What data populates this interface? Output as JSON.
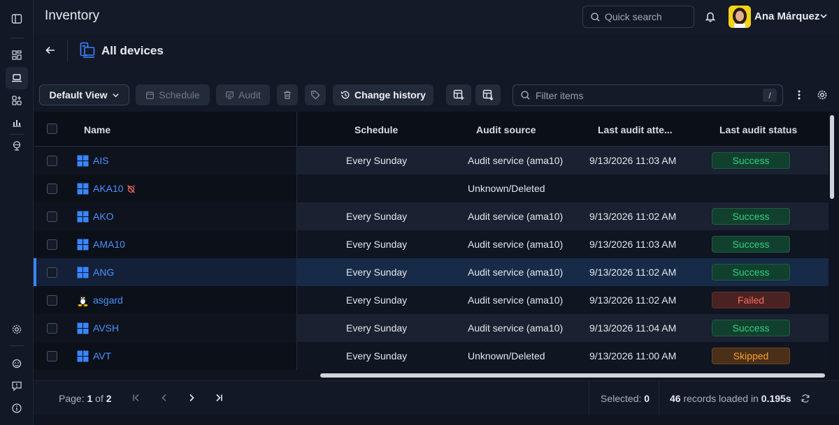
{
  "header": {
    "app_title": "Inventory",
    "search_placeholder": "Quick search",
    "user_name": "Ana Márquez"
  },
  "subheader": {
    "title": "All devices"
  },
  "toolbar": {
    "view_label": "Default View",
    "schedule_label": "Schedule",
    "audit_label": "Audit",
    "change_history_label": "Change history",
    "filter_placeholder": "Filter items",
    "filter_shortcut": "/"
  },
  "table": {
    "columns": [
      "Name",
      "Schedule",
      "Audit source",
      "Last audit atte...",
      "Last audit status"
    ],
    "rows": [
      {
        "name": "AIS",
        "os": "windows",
        "schedule": "Every Sunday",
        "source": "Audit service (ama10)",
        "last_attempt": "9/13/2026 11:03 AM",
        "status": "Success",
        "status_kind": "success",
        "no_audit": false
      },
      {
        "name": "AKA10",
        "os": "windows",
        "schedule": "",
        "source": "Unknown/Deleted",
        "last_attempt": "",
        "status": "",
        "status_kind": "",
        "no_audit": true
      },
      {
        "name": "AKO",
        "os": "windows",
        "schedule": "Every Sunday",
        "source": "Audit service (ama10)",
        "last_attempt": "9/13/2026 11:02 AM",
        "status": "Success",
        "status_kind": "success",
        "no_audit": false
      },
      {
        "name": "AMA10",
        "os": "windows",
        "schedule": "Every Sunday",
        "source": "Audit service (ama10)",
        "last_attempt": "9/13/2026 11:03 AM",
        "status": "Success",
        "status_kind": "success",
        "no_audit": false
      },
      {
        "name": "ANG",
        "os": "windows",
        "schedule": "Every Sunday",
        "source": "Audit service (ama10)",
        "last_attempt": "9/13/2026 11:02 AM",
        "status": "Success",
        "status_kind": "success",
        "no_audit": false
      },
      {
        "name": "asgard",
        "os": "linux",
        "schedule": "Every Sunday",
        "source": "Audit service (ama10)",
        "last_attempt": "9/13/2026 11:02 AM",
        "status": "Failed",
        "status_kind": "failed",
        "no_audit": false
      },
      {
        "name": "AVSH",
        "os": "windows",
        "schedule": "Every Sunday",
        "source": "Audit service (ama10)",
        "last_attempt": "9/13/2026 11:04 AM",
        "status": "Success",
        "status_kind": "success",
        "no_audit": false
      },
      {
        "name": "AVT",
        "os": "windows",
        "schedule": "Every Sunday",
        "source": "Unknown/Deleted",
        "last_attempt": "9/13/2026 11:00 AM",
        "status": "Skipped",
        "status_kind": "skipped",
        "no_audit": false
      }
    ]
  },
  "footer": {
    "page_label": "Page:",
    "page_current": "1",
    "page_of": "of",
    "page_total": "2",
    "selected_label": "Selected:",
    "selected_count": "0",
    "records_count": "46",
    "records_text": "records loaded in",
    "records_time": "0.195s"
  },
  "colors": {
    "accent": "#3a86ff",
    "link": "#4a92ff",
    "success": "#2fd47c",
    "failed": "#ff6b63",
    "skipped": "#ff9f2e"
  },
  "icons": [
    "sidebar-toggle-icon",
    "dashboard-icon",
    "laptop-icon",
    "apps-icon",
    "reports-icon",
    "globe-icon",
    "settings-icon",
    "support-icon",
    "feedback-icon",
    "info-icon",
    "search-icon",
    "bell-icon",
    "chevron-down-icon",
    "back-arrow-icon",
    "devices-icon",
    "calendar-icon",
    "audit-icon",
    "trash-icon",
    "tag-icon",
    "history-icon",
    "table-add-icon",
    "table-settings-icon",
    "filter-search-icon",
    "more-vertical-icon",
    "gear-icon",
    "windows-icon",
    "linux-icon",
    "no-audit-icon",
    "first-page-icon",
    "prev-page-icon",
    "next-page-icon",
    "last-page-icon",
    "refresh-icon"
  ]
}
